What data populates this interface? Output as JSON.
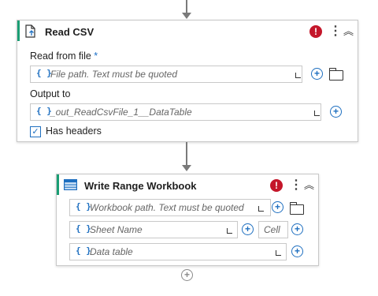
{
  "read_csv": {
    "title": "Read CSV",
    "read_from_file_label": "Read from file",
    "required_marker": "*",
    "file_path_placeholder": "File path. Text must be quoted",
    "output_label": "Output to",
    "output_value": "_out_ReadCsvFile_1__DataTable",
    "has_headers_label": "Has headers",
    "has_headers_checked": true
  },
  "write_range": {
    "title": "Write Range Workbook",
    "workbook_placeholder": "Workbook path. Text must be quoted",
    "sheet_placeholder": "Sheet Name",
    "cell_placeholder": "Cell",
    "data_table_placeholder": "Data table"
  },
  "icons": {
    "error": "!",
    "kebab": "⋮",
    "collapse": "︽",
    "brace": "{ }",
    "plus": "+",
    "check": "✓",
    "add_activity": "+"
  },
  "colors": {
    "accent": "#1a9e74",
    "error": "#c4162a",
    "link_blue": "#1e6fc0"
  }
}
